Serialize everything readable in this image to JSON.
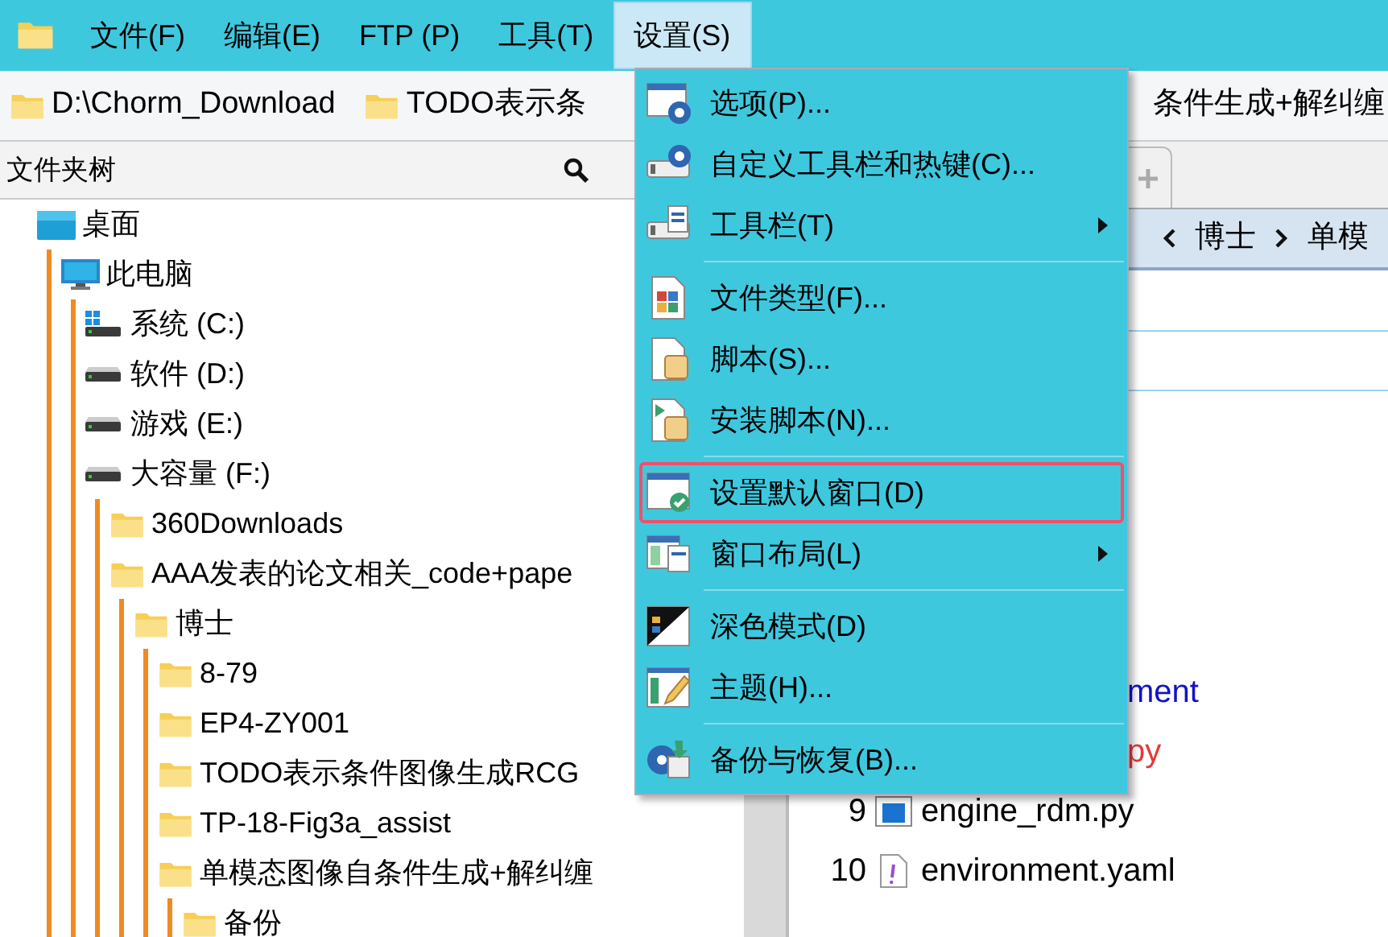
{
  "menubar": [
    {
      "label": "文件(F)",
      "selected": false
    },
    {
      "label": "编辑(E)",
      "selected": false
    },
    {
      "label": "FTP (P)",
      "selected": false
    },
    {
      "label": "工具(T)",
      "selected": false
    },
    {
      "label": "设置(S)",
      "selected": true
    }
  ],
  "bookmarks": [
    {
      "label": "D:\\Chorm_Download",
      "kind": "folder"
    },
    {
      "label": "TODO表示条",
      "kind": "folder"
    },
    {
      "label": "条件生成+解纠缠",
      "kind": "plain"
    }
  ],
  "folder_tree": {
    "title": "文件夹树",
    "items": [
      {
        "label": "桌面",
        "kind": "desktop",
        "children": [
          {
            "label": "此电脑",
            "kind": "computer",
            "children": [
              {
                "label": "系统 (C:)",
                "kind": "system-drive"
              },
              {
                "label": "软件 (D:)",
                "kind": "drive"
              },
              {
                "label": "游戏 (E:)",
                "kind": "drive"
              },
              {
                "label": "大容量 (F:)",
                "kind": "drive",
                "children": [
                  {
                    "label": "360Downloads",
                    "kind": "folder"
                  },
                  {
                    "label": "AAA发表的论文相关_code+pape",
                    "kind": "folder",
                    "children": [
                      {
                        "label": "博士",
                        "kind": "folder",
                        "children": [
                          {
                            "label": "8-79",
                            "kind": "folder"
                          },
                          {
                            "label": "EP4-ZY001",
                            "kind": "folder"
                          },
                          {
                            "label": "TODO表示条件图像生成RCG",
                            "kind": "folder"
                          },
                          {
                            "label": "TP-18-Fig3a_assist",
                            "kind": "folder"
                          },
                          {
                            "label": "单模态图像自条件生成+解纠缠",
                            "kind": "folder",
                            "children": [
                              {
                                "label": "备份",
                                "kind": "folder"
                              }
                            ]
                          }
                        ]
                      }
                    ]
                  }
                ]
              }
            ]
          }
        ]
      }
    ]
  },
  "file_pane": {
    "breadcrumb": [
      "博士",
      "单模"
    ],
    "rows": [
      {
        "name": "ment",
        "kind": "partial",
        "color": "#1212c8"
      },
      {
        "name": "py",
        "kind": "partial",
        "color": "#e33b3b"
      },
      {
        "number": "9",
        "name": "engine_rdm.py",
        "kind": "python"
      },
      {
        "number": "10",
        "name": "environment.yaml",
        "kind": "yaml"
      }
    ]
  },
  "settings_menu": {
    "items": [
      {
        "label": "选项(P)...",
        "kind": "item",
        "selected": false
      },
      {
        "label": "自定义工具栏和热键(C)...",
        "kind": "item",
        "selected": false
      },
      {
        "label": "工具栏(T)",
        "kind": "submenu",
        "selected": false
      },
      {
        "kind": "separator"
      },
      {
        "label": "文件类型(F)...",
        "kind": "item",
        "selected": false
      },
      {
        "label": "脚本(S)...",
        "kind": "item",
        "selected": false
      },
      {
        "label": "安装脚本(N)...",
        "kind": "item",
        "selected": false
      },
      {
        "kind": "separator"
      },
      {
        "label": "设置默认窗口(D)",
        "kind": "item",
        "selected": true
      },
      {
        "label": "窗口布局(L)",
        "kind": "submenu",
        "selected": false
      },
      {
        "kind": "separator"
      },
      {
        "label": "深色模式(D)",
        "kind": "item",
        "selected": false
      },
      {
        "label": "主题(H)...",
        "kind": "item",
        "selected": false
      },
      {
        "kind": "separator"
      },
      {
        "label": "备份与恢复(B)...",
        "kind": "item",
        "selected": false
      }
    ]
  }
}
